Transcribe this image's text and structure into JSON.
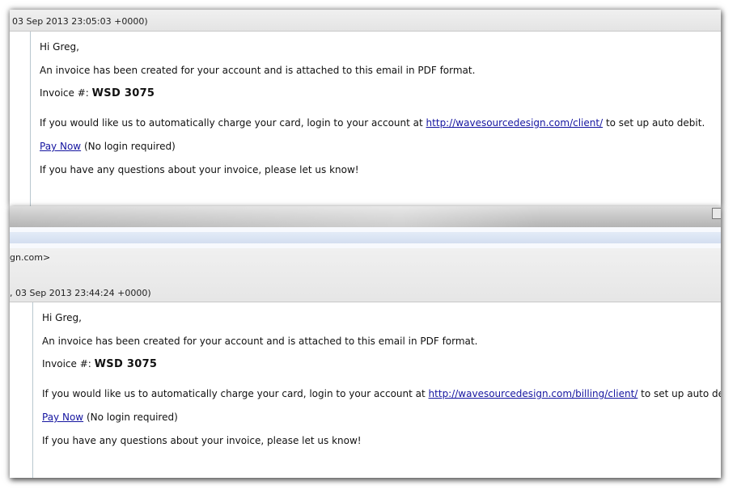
{
  "email1": {
    "date": "03 Sep 2013 23:05:03 +0000)",
    "greeting": "Hi Greg,",
    "line1": "An invoice has been created for your account and is attached to this email in PDF format.",
    "invoice_label": "Invoice #:",
    "invoice_number": "WSD 3075",
    "line2_before": "If you would like us to automatically charge your card, login to your account at",
    "link_url": "http://wavesourcedesign.com/client/",
    "line2_after": "to set up auto debit.",
    "pay_now": "Pay Now",
    "no_login": "(No login required)",
    "questions": "If you have any questions about your invoice, please let us know!"
  },
  "email2": {
    "from_partial": "gn.com>",
    "date": ", 03 Sep 2013 23:44:24 +0000)",
    "greeting": "Hi Greg,",
    "line1": "An invoice has been created for your account and is attached to this email in PDF format.",
    "invoice_label": "Invoice #:",
    "invoice_number": "WSD 3075",
    "line2_before": "If you would like us to automatically charge your card, login to your account at",
    "link_url": "http://wavesourcedesign.com/billing/client/",
    "line2_after": "to set up auto debit.",
    "pay_now": "Pay Now",
    "no_login": "(No login required)",
    "questions": "If you have any questions about your invoice, please let us know!"
  }
}
